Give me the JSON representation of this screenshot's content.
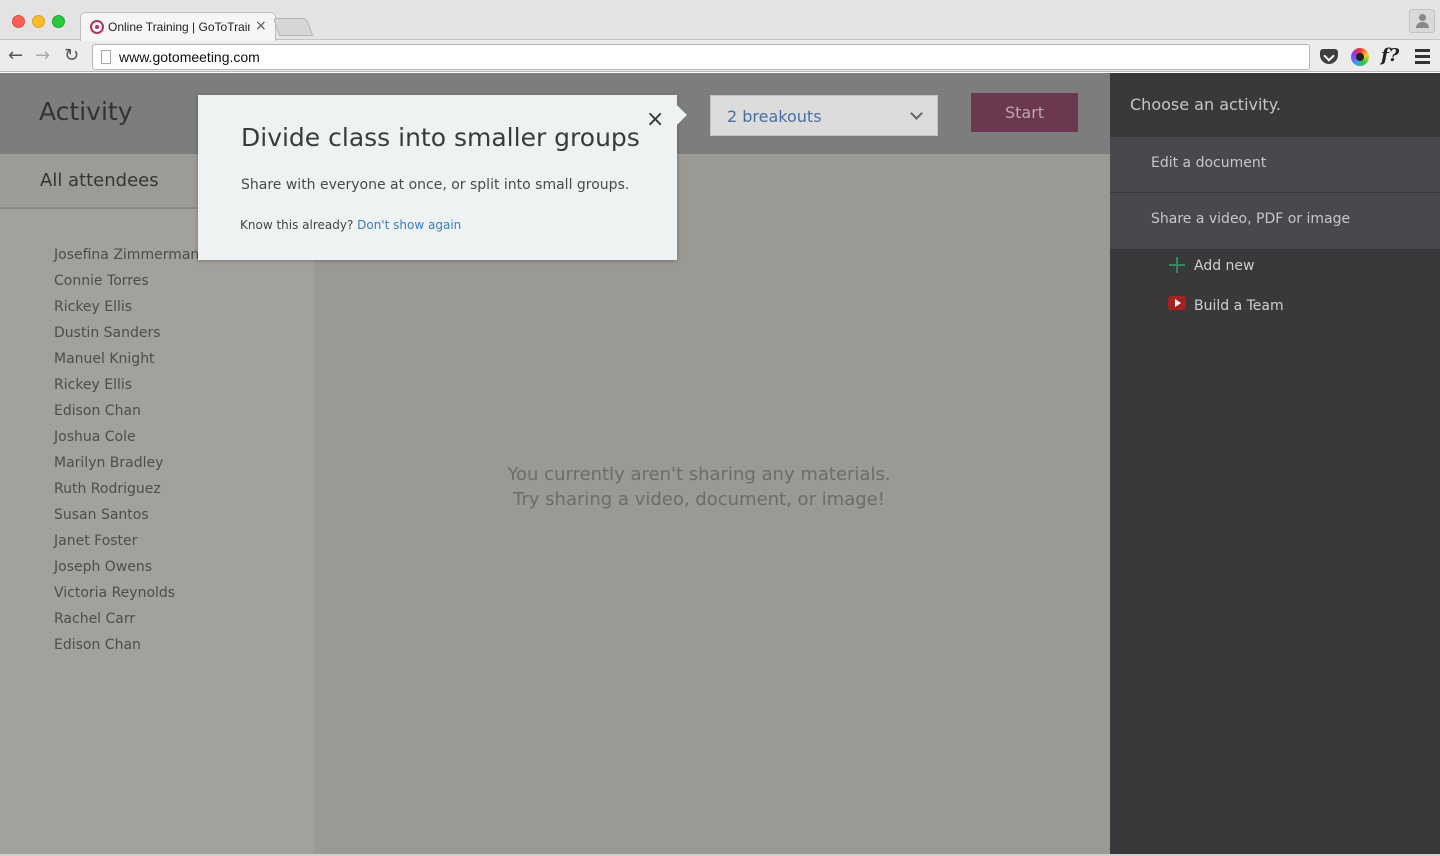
{
  "browser": {
    "tab_title": "Online Training | GoToTrain",
    "tab_close": "×",
    "url": "www.gotomeeting.com",
    "ext_text": "f?"
  },
  "app": {
    "title": "Activity",
    "breakouts_value": "2 breakouts",
    "start_label": "Start"
  },
  "sidebar": {
    "header": "All attendees",
    "attendees": [
      "Josefina Zimmerman",
      "Connie Torres",
      "Rickey Ellis",
      "Dustin Sanders",
      "Manuel Knight",
      "Rickey Ellis",
      "Edison Chan",
      "Joshua Cole",
      "Marilyn Bradley",
      "Ruth Rodriguez",
      "Susan Santos",
      "Janet Foster",
      "Joseph Owens",
      "Victoria Reynolds",
      "Rachel Carr",
      "Edison Chan"
    ]
  },
  "main": {
    "empty_line1": "You currently aren't sharing any materials.",
    "empty_line2": "Try sharing a video, document, or image!"
  },
  "right_panel": {
    "heading": "Choose an activity.",
    "edit_document": "Edit a document",
    "share_media": "Share a video, PDF or image",
    "add_new": "Add new",
    "build_team": "Build a Team"
  },
  "popover": {
    "close": "×",
    "title": "Divide class into smaller groups",
    "description": "Share with everyone at once, or split into small groups.",
    "know_prefix": "Know this already?",
    "dont_show": "Don't show again"
  },
  "colors": {
    "start_button": "#6c3850",
    "link": "#3a7cc4",
    "right_panel_bg": "#39393c",
    "overlay_gray": "#9a9994"
  }
}
